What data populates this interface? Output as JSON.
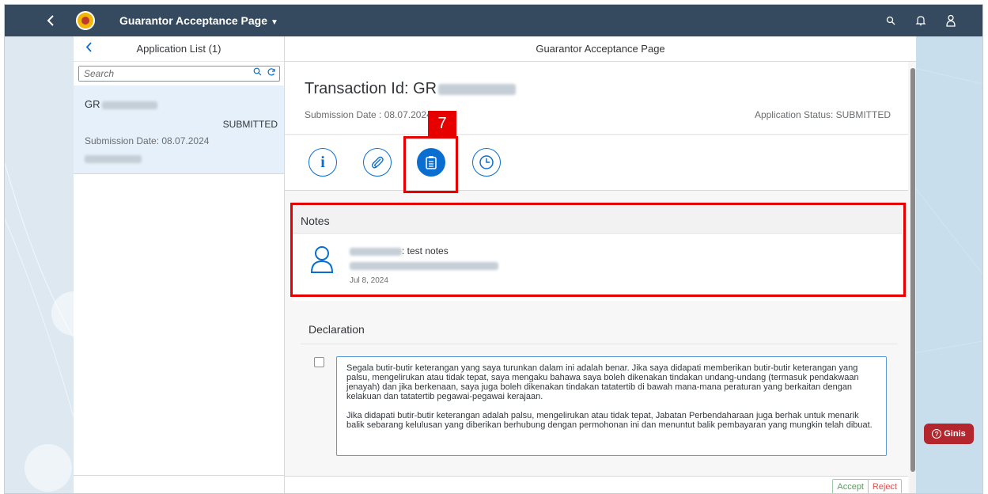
{
  "shell": {
    "title": "Guarantor Acceptance Page",
    "title_caret": "▼",
    "icons": [
      "back-icon",
      "app-logo",
      "search-icon",
      "bell-icon",
      "user-icon"
    ]
  },
  "master": {
    "title": "Application List (1)",
    "search_placeholder": "Search",
    "items": [
      {
        "title": "GR",
        "status": "SUBMITTED",
        "date": "Submission Date: 08.07.2024"
      }
    ]
  },
  "detail": {
    "header_title": "Guarantor Acceptance Page",
    "transaction_label": "Transaction Id: GR",
    "submission_date": "Submission Date : 08.07.2024",
    "application_status": "Application Status: SUBMITTED",
    "tabs": [
      {
        "icon": "info-icon",
        "glyph": "i"
      },
      {
        "icon": "attachment-icon"
      },
      {
        "icon": "notes-icon",
        "selected": true
      },
      {
        "icon": "history-icon"
      }
    ],
    "step_badge": "7",
    "notes": {
      "title": "Notes",
      "text": ": test notes",
      "date": "Jul 8, 2024"
    },
    "declaration": {
      "title": "Declaration",
      "paragraph1": "Segala butir-butir keterangan yang saya turunkan dalam ini adalah benar. Jika saya didapati memberikan butir-butir keterangan yang palsu, mengelirukan atau tidak tepat, saya mengaku bahawa saya boleh dikenakan tindakan undang-undang (termasuk pendakwaan jenayah) dan jika berkenaan, saya juga boleh dikenakan tindakan tatatertib di bawah mana-mana peraturan yang berkaitan dengan kelakuan dan tatatertib pegawai-pegawai kerajaan.",
      "paragraph2": "Jika didapati butir-butir keterangan adalah palsu, mengelirukan atau tidak tepat, Jabatan Perbendaharaan juga berhak untuk menarik balik sebarang kelulusan yang diberikan berhubung dengan permohonan ini dan menuntut balik pembayaran yang mungkin telah dibuat."
    },
    "buttons": {
      "accept": "Accept",
      "reject": "Reject"
    }
  },
  "ginis": {
    "label": "Ginis",
    "glyph": "?"
  },
  "colors": {
    "shell": "#354a5f",
    "accent": "#0a6ed1",
    "highlight": "#e60000",
    "ginis": "#b3262e"
  }
}
